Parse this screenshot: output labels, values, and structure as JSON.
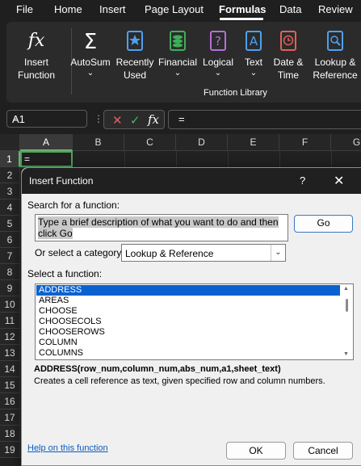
{
  "menu": {
    "tabs": [
      "File",
      "Home",
      "Insert",
      "Page Layout",
      "Formulas",
      "Data",
      "Review"
    ],
    "active": "Formulas"
  },
  "ribbon": {
    "insert_function": "Insert\nFunction",
    "autosum": "AutoSum",
    "recently_used": "Recently\nUsed",
    "financial": "Financial",
    "logical": "Logical",
    "text": "Text",
    "date_time": "Date &\nTime",
    "lookup_reference": "Lookup &\nReference",
    "group_label": "Function Library",
    "colors": {
      "accent_blue": "#4ea0f0",
      "financial_green": "#3fae5a",
      "logical_purple": "#b36fd8",
      "date_red": "#e0615c"
    }
  },
  "formula_bar": {
    "name_box": "A1",
    "value": "="
  },
  "grid": {
    "columns": [
      "A",
      "B",
      "C",
      "D",
      "E",
      "F",
      "G"
    ],
    "rows": [
      "1",
      "2",
      "3",
      "4",
      "5",
      "6",
      "7",
      "8",
      "9",
      "10",
      "11",
      "12",
      "13",
      "14",
      "15",
      "16",
      "17",
      "18",
      "19"
    ],
    "active_cell_value": "="
  },
  "dialog": {
    "title": "Insert Function",
    "help_glyph": "?",
    "close_glyph": "✕",
    "search_label": "Search for a function:",
    "search_text": "Type a brief description of what you want to do and then click Go",
    "go_button": "Go",
    "category_label": "Or select a category:",
    "category_value": "Lookup & Reference",
    "select_label": "Select a function:",
    "functions": [
      "ADDRESS",
      "AREAS",
      "CHOOSE",
      "CHOOSECOLS",
      "CHOOSEROWS",
      "COLUMN",
      "COLUMNS"
    ],
    "selected_function": "ADDRESS",
    "signature": "ADDRESS(row_num,column_num,abs_num,a1,sheet_text)",
    "description": "Creates a cell reference as text, given specified row and column numbers.",
    "help_link": "Help on this function",
    "ok_button": "OK",
    "cancel_button": "Cancel"
  }
}
